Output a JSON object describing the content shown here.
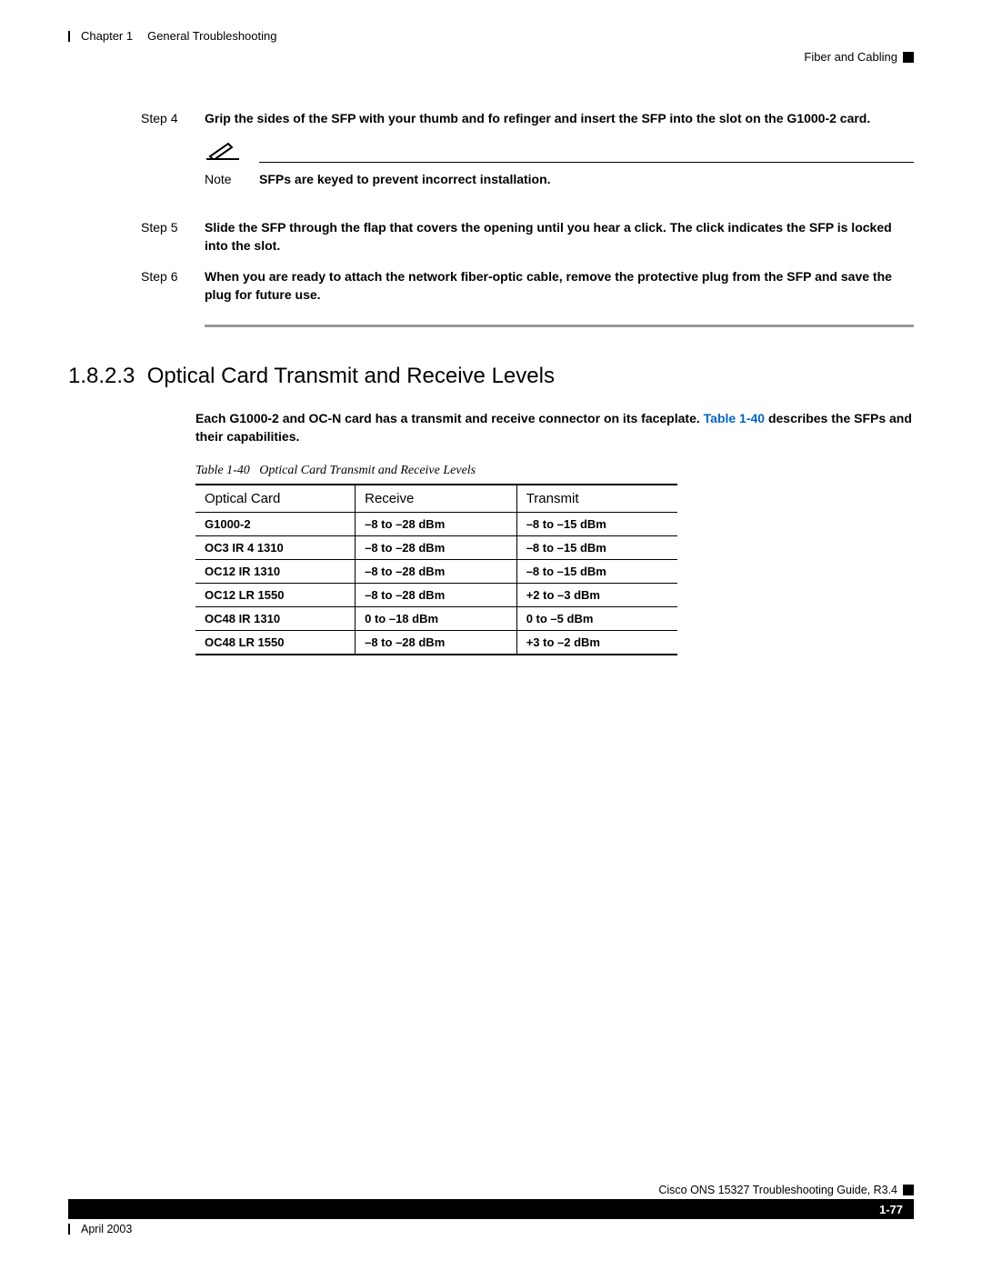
{
  "header": {
    "chapter": "Chapter 1",
    "chapter_title": "General Troubleshooting",
    "breadcrumb_right": "Fiber and Cabling"
  },
  "steps": [
    {
      "label": "Step 4",
      "text": "Grip the sides of the SFP with your thumb and fo refinger and insert the SFP into the slot on the G1000-2 card."
    },
    {
      "label": "Step 5",
      "text": "Slide the SFP through the flap that covers the opening until you hear a click. The click indicates the SFP is locked into the slot."
    },
    {
      "label": "Step 6",
      "text": "When you are ready to attach the network fiber-optic cable, remove the protective plug from the SFP and save the plug for future use."
    }
  ],
  "note": {
    "label": "Note",
    "text": "SFPs are keyed to prevent incorrect installation."
  },
  "section": {
    "number": "1.8.2.3",
    "title": "Optical Card Transmit and Receive Levels",
    "intro_before": "Each G1000-2 and OC-N card has a transmit and receive connector on its faceplate. ",
    "intro_link": "Table 1-40",
    "intro_after": " describes the SFPs and their capabilities."
  },
  "table": {
    "caption_prefix": "Table 1-40",
    "caption_title": "Optical Card Transmit and Receive Levels",
    "headers": [
      "Optical Card",
      "Receive",
      "Transmit"
    ],
    "rows": [
      [
        "G1000-2",
        "–8 to –28 dBm",
        "–8 to –15 dBm"
      ],
      [
        "OC3 IR 4 1310",
        "–8 to –28 dBm",
        "–8 to –15 dBm"
      ],
      [
        "OC12 IR 1310",
        "–8 to –28 dBm",
        "–8 to –15 dBm"
      ],
      [
        "OC12 LR 1550",
        "–8 to –28 dBm",
        "+2 to –3 dBm"
      ],
      [
        "OC48 IR 1310",
        "0 to –18 dBm",
        "0 to –5 dBm"
      ],
      [
        "OC48 LR 1550",
        "–8 to –28 dBm",
        "+3 to –2 dBm"
      ]
    ]
  },
  "footer": {
    "doc_title": "Cisco ONS 15327 Troubleshooting Guide, R3.4",
    "page": "1-77",
    "date": "April 2003"
  }
}
